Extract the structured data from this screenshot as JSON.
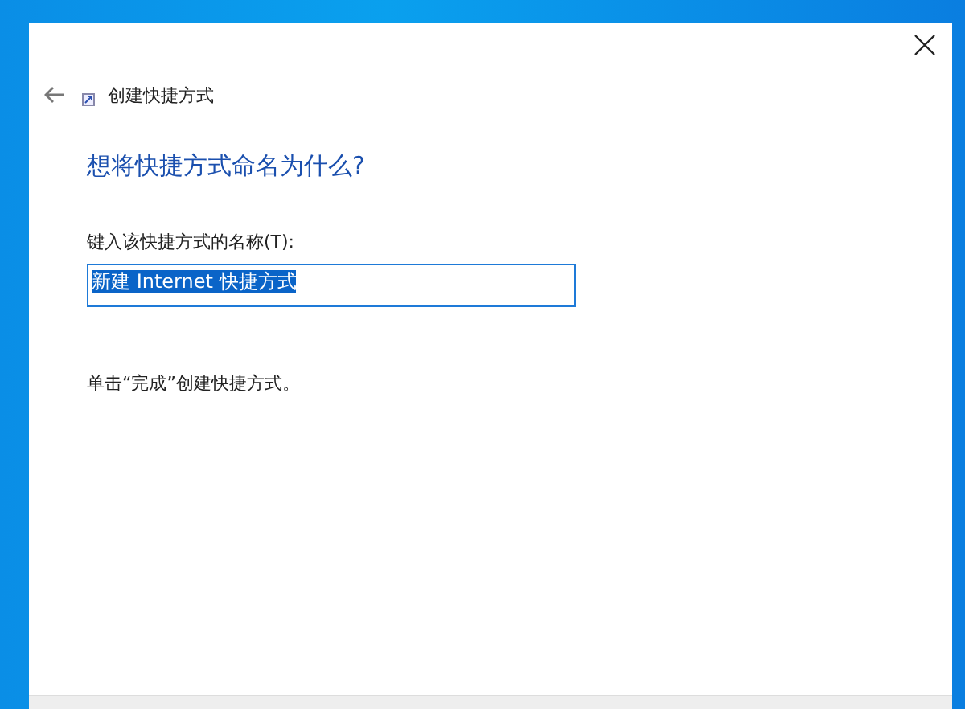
{
  "window": {
    "title": "创建快捷方式"
  },
  "heading": "想将快捷方式命名为什么?",
  "name_field": {
    "label": "键入该快捷方式的名称(T):",
    "value": "新建 Internet 快捷方式",
    "text_selected": true
  },
  "hint": "单击“完成”创建快捷方式。"
}
